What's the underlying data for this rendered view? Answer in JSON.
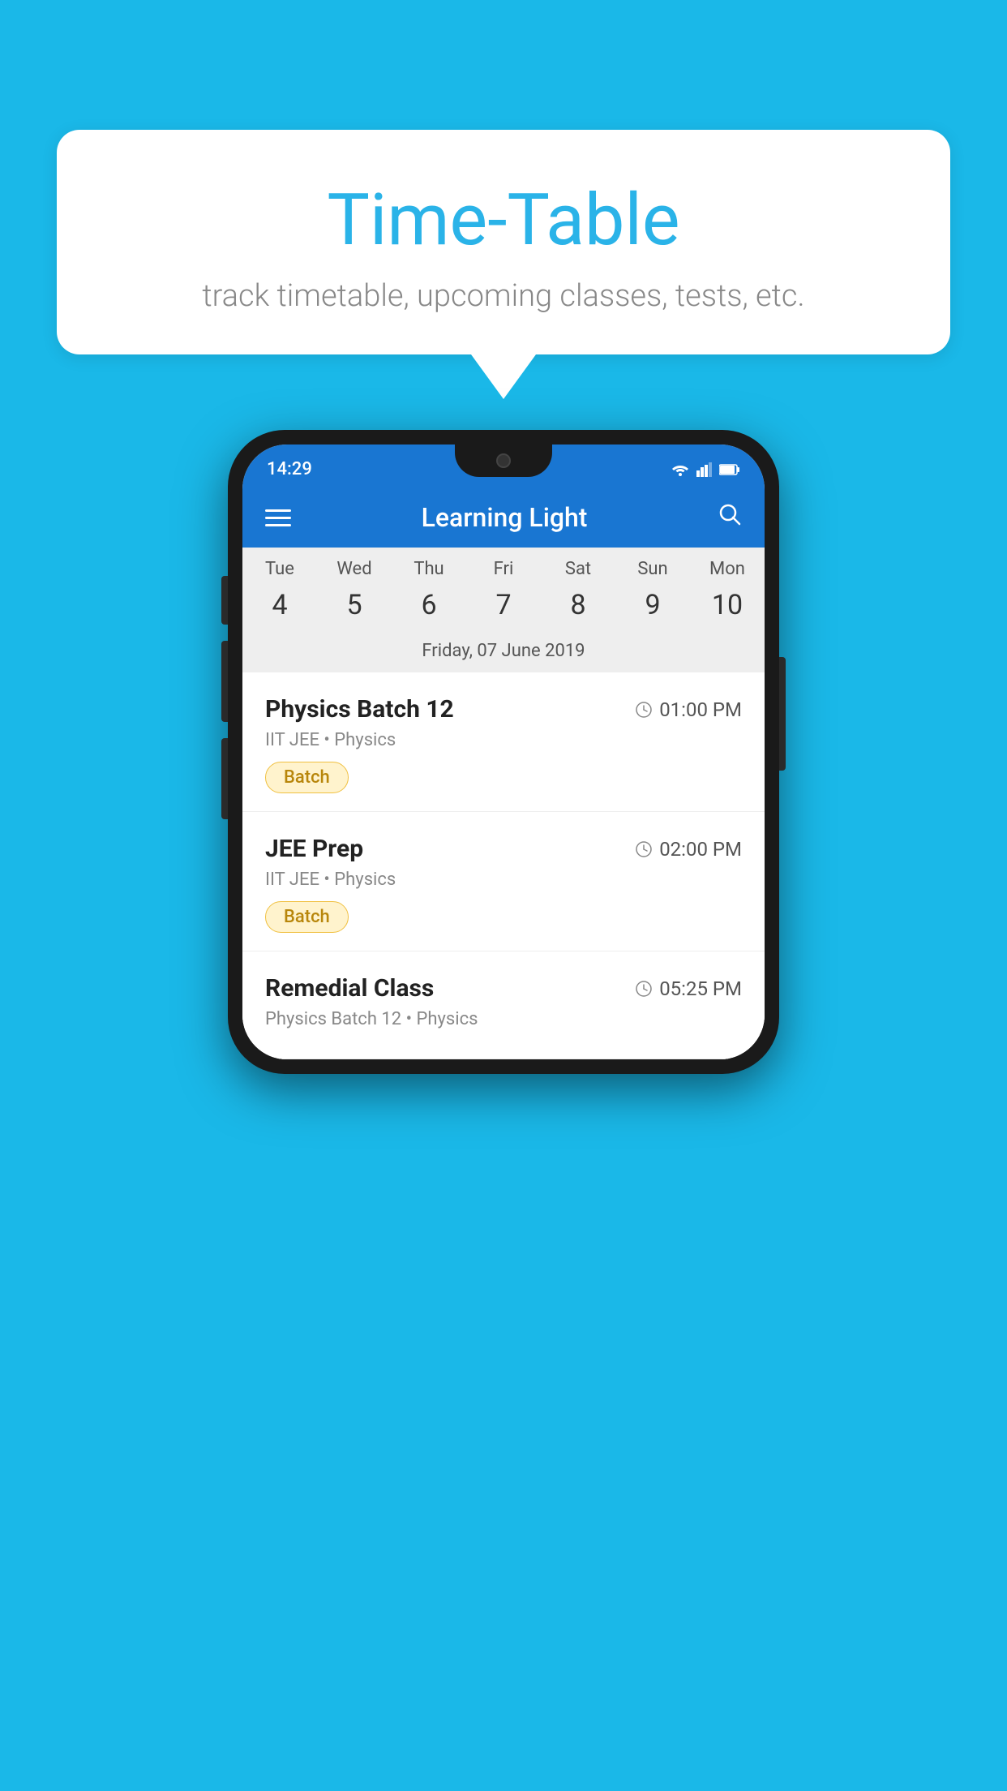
{
  "background_color": "#1ab8e8",
  "speech_bubble": {
    "title": "Time-Table",
    "subtitle": "track timetable, upcoming classes, tests, etc."
  },
  "phone": {
    "status_bar": {
      "time": "14:29",
      "icons": "▼◄█"
    },
    "app_bar": {
      "title": "Learning Light",
      "hamburger_label": "menu",
      "search_label": "search"
    },
    "calendar": {
      "day_headers": [
        "Tue",
        "Wed",
        "Thu",
        "Fri",
        "Sat",
        "Sun",
        "Mon"
      ],
      "day_numbers": [
        "4",
        "5",
        "6",
        "7",
        "8",
        "9",
        "10"
      ],
      "today_index": 2,
      "selected_index": 3,
      "selected_date_label": "Friday, 07 June 2019"
    },
    "classes": [
      {
        "name": "Physics Batch 12",
        "time": "01:00 PM",
        "meta": "IIT JEE • Physics",
        "badge": "Batch"
      },
      {
        "name": "JEE Prep",
        "time": "02:00 PM",
        "meta": "IIT JEE • Physics",
        "badge": "Batch"
      },
      {
        "name": "Remedial Class",
        "time": "05:25 PM",
        "meta": "Physics Batch 12 • Physics",
        "badge": ""
      }
    ]
  }
}
